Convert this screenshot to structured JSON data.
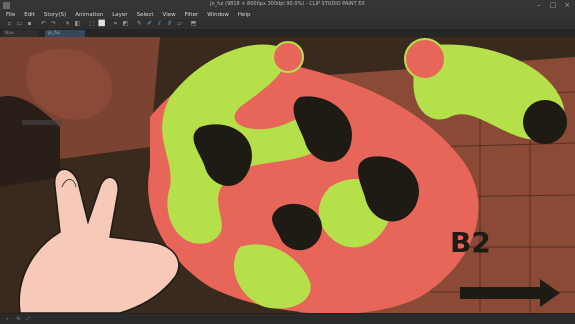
{
  "window": {
    "title": "jo_fui (9818 × 8000px 300dpi 90.0%)  - CLIP STUDIO PAINT EX"
  },
  "menu": {
    "items": [
      "File",
      "Edit",
      "Story(S)",
      "Animation",
      "Layer",
      "Select",
      "View",
      "Filter",
      "Window",
      "Help"
    ]
  },
  "tabs": [
    {
      "label": "Nav"
    },
    {
      "label": "jo_fui"
    }
  ],
  "colors": {
    "bg": "#3a2a1e",
    "brick": "#8a4a35",
    "coral": "#e8655a",
    "lime": "#b6e04a",
    "skin": "#f6c9b8",
    "ink": "#1e1a14"
  },
  "canvas": {
    "signage": "B2"
  },
  "icons": [
    "app-icon",
    "minimize-icon",
    "maximize-icon",
    "close-icon",
    "undo-icon",
    "redo-icon",
    "brush-icon",
    "eraser-icon",
    "select-icon"
  ]
}
